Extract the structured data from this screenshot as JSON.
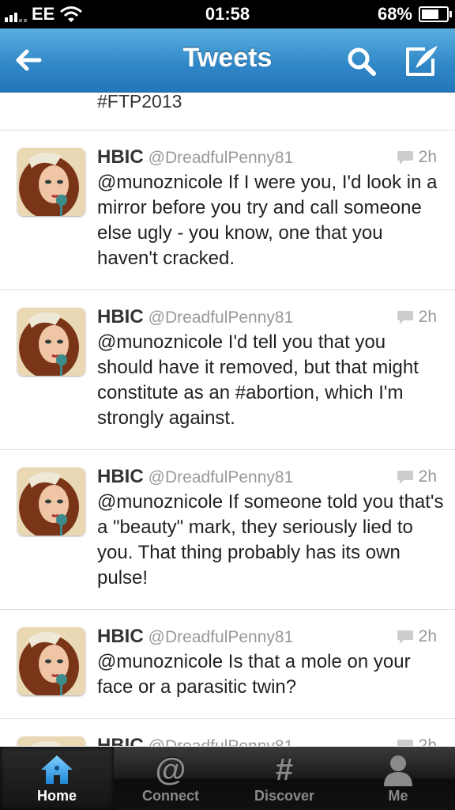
{
  "status_bar": {
    "carrier": "EE",
    "time": "01:58",
    "battery": "68%",
    "battery_level": 0.68
  },
  "nav": {
    "title": "Tweets",
    "back_icon": "back-arrow-icon",
    "search_icon": "search-icon",
    "compose_icon": "compose-icon"
  },
  "timeline": {
    "previous_tail": "#FTP2013",
    "tweets": [
      {
        "name": "HBIC",
        "handle": "@DreadfulPenny81",
        "time": "2h",
        "text": "@munoznicole If I were you, I'd look in a mirror before you try and call someone else ugly - you know, one that you haven't cracked."
      },
      {
        "name": "HBIC",
        "handle": "@DreadfulPenny81",
        "time": "2h",
        "text": "@munoznicole I'd tell you that you should have it removed, but that might constitute as an #abortion, which I'm strongly against."
      },
      {
        "name": "HBIC",
        "handle": "@DreadfulPenny81",
        "time": "2h",
        "text": "@munoznicole If someone told you that's a \"beauty\" mark, they seriously lied to you. That thing probably has its own pulse!"
      },
      {
        "name": "HBIC",
        "handle": "@DreadfulPenny81",
        "time": "2h",
        "text": "@munoznicole Is that a mole on your face or a parasitic twin?"
      },
      {
        "name": "HBIC",
        "handle": "@DreadfulPenny81",
        "time": "2h",
        "text": ""
      }
    ]
  },
  "tabs": [
    {
      "label": "Home",
      "icon": "home-icon",
      "active": true
    },
    {
      "label": "Connect",
      "icon": "at-icon",
      "active": false
    },
    {
      "label": "Discover",
      "icon": "hashtag-icon",
      "active": false
    },
    {
      "label": "Me",
      "icon": "person-icon",
      "active": false
    }
  ],
  "colors": {
    "nav_blue": "#2f86c6",
    "text": "#222222",
    "meta": "#999999"
  }
}
